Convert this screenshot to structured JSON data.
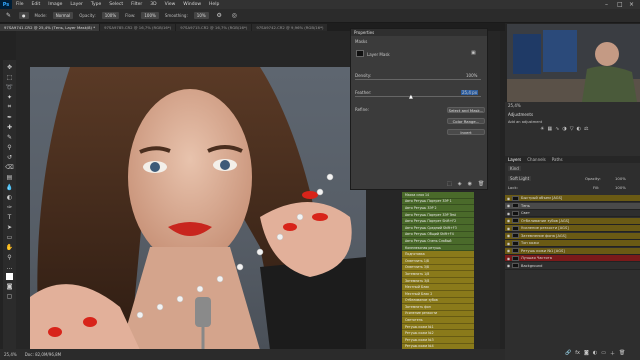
{
  "menubar": {
    "items": [
      "File",
      "Edit",
      "Image",
      "Layer",
      "Type",
      "Select",
      "Filter",
      "3D",
      "View",
      "Window",
      "Help"
    ]
  },
  "options": {
    "mode_label": "Mode:",
    "mode_value": "Normal",
    "opacity_label": "Opacity:",
    "opacity_value": "100%",
    "flow_label": "Flow:",
    "flow_value": "100%",
    "smoothing_label": "Smoothing:",
    "smoothing_value": "10%"
  },
  "tabs": [
    {
      "label": "97SA9741.CR2 @ 25,4% (Тень, Layer Mask/8) *",
      "active": true
    },
    {
      "label": "97SA9785.CR2 @ 16,7% (RGB/16*)",
      "active": false
    },
    {
      "label": "97SA9715.CR2 @ 16,7% (RGB/16*)",
      "active": false
    },
    {
      "label": "97SA9742.CR2 @ 9,96% (RGB/16*)",
      "active": false
    }
  ],
  "status": {
    "zoom": "25,4%",
    "doc": "Doc: 82,0M/96,8M"
  },
  "properties": {
    "title": "Properties",
    "masks_label": "Masks",
    "mask_type": "Layer Mask",
    "density_label": "Density:",
    "density_value": "100%",
    "feather_label": "Feather:",
    "feather_value": "25,4 px",
    "refine_label": "Refine:",
    "select_mask_btn": "Select and Mask...",
    "color_range_btn": "Color Range...",
    "invert_btn": "Invert"
  },
  "actions_panel": {
    "rows": [
      {
        "label": "Маска слоя 14",
        "color": "#4a6a2a"
      },
      {
        "label": "Авто Ретушь Портрет 3ЭР 1",
        "color": "#4a6a2a"
      },
      {
        "label": "Авто Ретушь 3ЭР 2",
        "color": "#4a6a2a"
      },
      {
        "label": "Авто Ретушь Портрет 3ЭР Test",
        "color": "#4a6a2a"
      },
      {
        "label": "Авто Ретушь Портрет        Shift+F2",
        "color": "#4a6a2a"
      },
      {
        "label": "Авто Ретушь Средний         Shift+F3",
        "color": "#4a6a2a"
      },
      {
        "label": "Авто Ретушь Общий           Shift+F4",
        "color": "#4a6a2a"
      },
      {
        "label": "Авто Ретушь Очень Слабый",
        "color": "#4a6a2a"
      },
      {
        "label": "Комплексная ретушь",
        "color": "#4a6a2a"
      },
      {
        "label": "Подготовка",
        "color": "#8a7a1a"
      },
      {
        "label": "Осветлить 1/8",
        "color": "#8a7a1a"
      },
      {
        "label": "Осветлить 3/8",
        "color": "#8a7a1a"
      },
      {
        "label": "Затемнить 1/8",
        "color": "#8a7a1a"
      },
      {
        "label": "Затемнить 3/8",
        "color": "#8a7a1a"
      },
      {
        "label": "Местный Блик",
        "color": "#8a7a1a"
      },
      {
        "label": "Местный Блик 2",
        "color": "#8a7a1a"
      },
      {
        "label": "Отбеливание зубов",
        "color": "#8a7a1a"
      },
      {
        "label": "Затемнить фон",
        "color": "#8a7a1a"
      },
      {
        "label": "Усиление резкости",
        "color": "#8a7a1a"
      },
      {
        "label": "Светотень",
        "color": "#8a7a1a"
      },
      {
        "label": "Ретушь кожи №1",
        "color": "#8a7a1a"
      },
      {
        "label": "Ретушь кожи №2",
        "color": "#8a7a1a"
      },
      {
        "label": "Ретушь кожи №3",
        "color": "#8a7a1a"
      },
      {
        "label": "Ретушь кожи №4",
        "color": "#8a7a1a"
      },
      {
        "label": "Ретушь кожи №5",
        "color": "#8a7a1a"
      }
    ]
  },
  "zoom_mini": "25,4%",
  "adjustments": {
    "title": "Adjustments",
    "subtitle": "Add an adjustment"
  },
  "layers_panel": {
    "tabs": [
      "Layers",
      "Channels",
      "Paths"
    ],
    "kind_label": "Kind",
    "blend": "Soft Light",
    "opacity_label": "Opacity:",
    "opacity_value": "100%",
    "fill_label": "Fill:",
    "fill_value": "100%",
    "lock_label": "Lock:",
    "layers": [
      {
        "name": "Быстрый объем [AGS]",
        "highlight": "#6a5a14"
      },
      {
        "name": "Тень",
        "highlight": "#4a4a4a"
      },
      {
        "name": "Свет",
        "highlight": ""
      },
      {
        "name": "Отбеливание зубов [AGS]",
        "highlight": "#6a5a14"
      },
      {
        "name": "Усиление резкости [AGS]",
        "highlight": "#6a5a14"
      },
      {
        "name": "Затемнение фона [AGS]",
        "highlight": "#6a5a14"
      },
      {
        "name": "Тон кожи",
        "highlight": "#6a5a14"
      },
      {
        "name": "Ретушь кожи №1 [AGS]",
        "highlight": "#6a5a14"
      },
      {
        "name": "Лучшая Частота",
        "highlight": "#7a1a1a"
      },
      {
        "name": "Background",
        "highlight": ""
      }
    ]
  }
}
